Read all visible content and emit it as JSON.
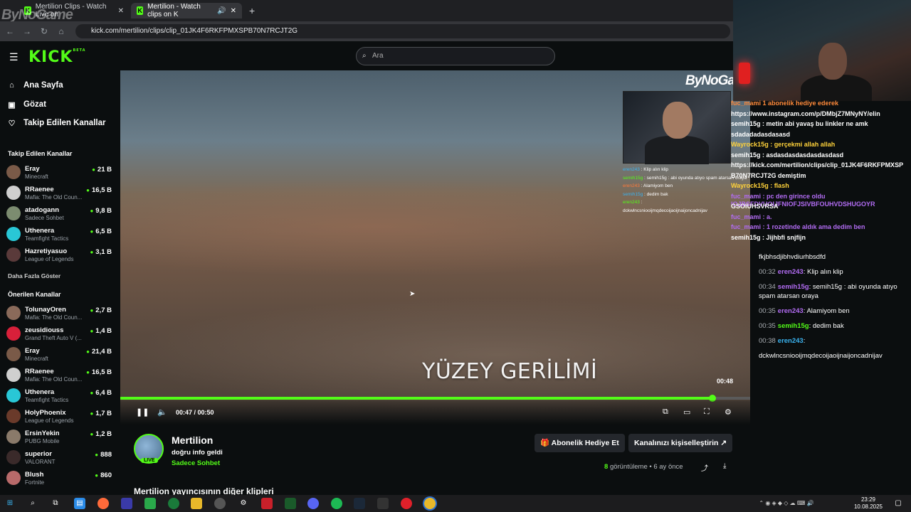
{
  "browser": {
    "tabs": [
      {
        "label": "Mertilion Clips - Watch Live on"
      },
      {
        "label": "Mertilion - Watch clips on K"
      }
    ],
    "url": "kick.com/mertilion/clips/clip_01JK4F6RKFPMXSPB70N7RCJT2G",
    "new_tab_icon": "+"
  },
  "watermark": "ByNoGame",
  "header": {
    "logo": "KICK",
    "logo_sup": "BETA",
    "search_placeholder": "Ara"
  },
  "sidebar": {
    "nav": [
      {
        "label": "Ana Sayfa",
        "icon": "home-icon"
      },
      {
        "label": "Gözat",
        "icon": "browse-icon"
      },
      {
        "label": "Takip Edilen Kanallar",
        "icon": "heart-icon"
      }
    ],
    "followed_title": "Takip Edilen Kanallar",
    "followed": [
      {
        "name": "Eray",
        "game": "Minecraft",
        "viewers": "21 B",
        "color": "#7a5a48"
      },
      {
        "name": "RRaenee",
        "game": "Mafia: The Old Coun...",
        "viewers": "16,5 B",
        "color": "#cfcfcf"
      },
      {
        "name": "atadogann",
        "game": "Sadece Sohbet",
        "viewers": "9,8 B",
        "color": "#7c8c70"
      },
      {
        "name": "Uthenera",
        "game": "Teamfight Tactics",
        "viewers": "6,5 B",
        "color": "#29c7d6"
      },
      {
        "name": "Hazretiyasuo",
        "game": "League of Legends",
        "viewers": "3,1 B",
        "color": "#5a3a3a"
      }
    ],
    "show_more": "Daha Fazla Göster",
    "recommended_title": "Önerilen Kanallar",
    "recommended": [
      {
        "name": "TolunayOren",
        "game": "Mafia: The Old Coun...",
        "viewers": "2,7 B",
        "color": "#8a6a5a"
      },
      {
        "name": "zeusidiouss",
        "game": "Grand Theft Auto V (...",
        "viewers": "1,4 B",
        "color": "#d8203a"
      },
      {
        "name": "Eray",
        "game": "Minecraft",
        "viewers": "21,4 B",
        "color": "#7a5a48"
      },
      {
        "name": "RRaenee",
        "game": "Mafia: The Old Coun...",
        "viewers": "16,5 B",
        "color": "#cfcfcf"
      },
      {
        "name": "Uthenera",
        "game": "Teamfight Tactics",
        "viewers": "6,4 B",
        "color": "#29c7d6"
      },
      {
        "name": "HolyPhoenix",
        "game": "League of Legends",
        "viewers": "1,7 B",
        "color": "#6a3a2a"
      },
      {
        "name": "ErsinYekin",
        "game": "PUBG Mobile",
        "viewers": "1,2 B",
        "color": "#8a7a6a"
      },
      {
        "name": "superior",
        "game": "VALORANT",
        "viewers": "888",
        "color": "#3a2a2a"
      },
      {
        "name": "Blush",
        "game": "Fortnite",
        "viewers": "860",
        "color": "#b86a6a"
      }
    ]
  },
  "video": {
    "watermark": "ByNoGa",
    "subtitle": "YÜZEY GERİLİMİ",
    "clip_time_label": "00:48",
    "timecode": "00:47 / 00:50",
    "progress": 0.94,
    "embedded_chat": [
      {
        "user": "eren243",
        "text": ": Klip alın klip"
      },
      {
        "user": "semih15g",
        "text": ": semih15g : abi oyunda atıyo spam atarsan oraya"
      },
      {
        "user": "eren243",
        "text": ": Alamiyom ben"
      },
      {
        "user": "semih15g",
        "text": ": dedim bak"
      },
      {
        "user": "eren243",
        "text": ":"
      },
      {
        "user": "",
        "text": "dckwlncsniooijmqdecoijaoijnaijoncadnijav"
      }
    ]
  },
  "clip_info": {
    "channel": "Mertilion",
    "live_badge": "LIVE",
    "title": "doğru info geldi",
    "category": "Sadece Sohbet",
    "gift_button": "Abonelik Hediye Et",
    "customize_button": "Kanalınızı kişiselleştirin",
    "views_count": "8",
    "views_label": "görüntüleme",
    "age": "• 6 ay önce",
    "other_clips": "Mertilion yayıncısının diğer klipleri"
  },
  "overlay_chat": [
    {
      "text": "fuc_mami    1 abonelik hediye ederek",
      "color": "#ff8a3a"
    },
    {
      "text": "https://www.instagram.com/p/DMbjZ7MNyNY/elin",
      "color": "#ffffff"
    },
    {
      "text": "semih15g : metin abi yavaş bu linkler ne amk",
      "color": "#ffffff"
    },
    {
      "text": "sdadadadasdasasd",
      "color": "#ffffff"
    },
    {
      "text": "Wayrock15g : gerçekmi      allah allah",
      "color": "#ffd23a"
    },
    {
      "text": "semih15g : asdasdasdasdasdasdasd",
      "color": "#ffffff"
    },
    {
      "text": "https://kick.com/mertilion/clips/clip_01JK4F6RKFPMXSP",
      "color": "#ffffff"
    },
    {
      "text": "B70N7RCJT2G       demiştim",
      "color": "#ffffff"
    },
    {
      "text": "Wayrock15g : flash",
      "color": "#ffd23a"
    },
    {
      "text": "fuc_mami : pc den girince oldu   lOJBSFDVUOIJFNIOFJSIVBFOUHVDSHUGOYR",
      "color": "#b26cf3"
    },
    {
      "text": "GSOIUHSVRSA",
      "color": "#ffffff"
    },
    {
      "text": "fuc_mami : a.",
      "color": "#b26cf3"
    },
    {
      "text": "fuc_mami : 1 rozetinde aldık    ama dedim ben",
      "color": "#b26cf3"
    },
    {
      "text": "semih15g : Jijhbfi snjfijn",
      "color": "#ffffff"
    }
  ],
  "right_chat": [
    {
      "time": "",
      "user": "",
      "text": "fkjbhsdjibhvdiurhbsdfd",
      "cls": "g"
    },
    {
      "time": "00:32",
      "user": "eren243",
      "text": ": Klip alın klip",
      "cls": "p"
    },
    {
      "time": "00:34",
      "user": "semih15g",
      "text": ": semih15g : abi oyunda atıyo spam atarsan oraya",
      "cls": "p"
    },
    {
      "time": "00:35",
      "user": "eren243",
      "text": ": Alamiyom ben",
      "cls": "p"
    },
    {
      "time": "00:35",
      "user": "semih15g",
      "text": ": dedim bak",
      "cls": "g"
    },
    {
      "time": "00:38",
      "user": "eren243",
      "text": ":",
      "cls": "b"
    },
    {
      "time": "",
      "user": "",
      "text": "dckwlncsniooijmqdecoijaoijnaijoncadnijav",
      "cls": "g"
    }
  ],
  "taskbar": {
    "time": "23:29",
    "date": "10.08.2025"
  }
}
